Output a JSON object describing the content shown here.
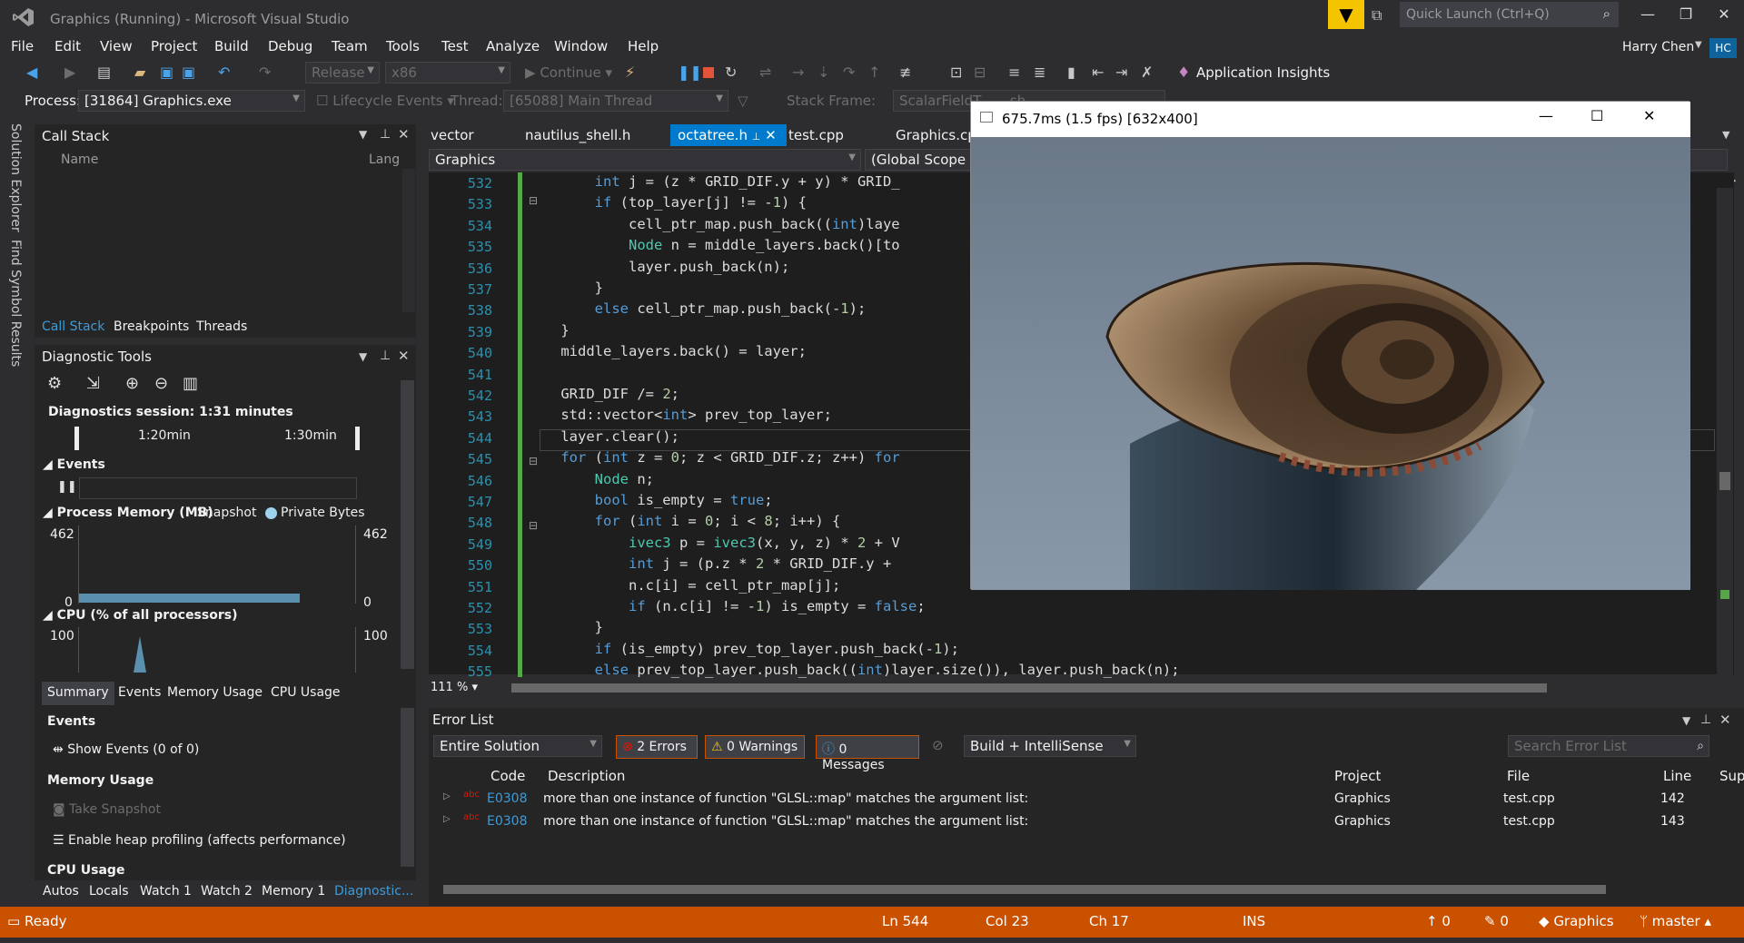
{
  "window": {
    "title": "Graphics (Running) - Microsoft Visual Studio",
    "quick_launch": "Quick Launch (Ctrl+Q)",
    "user": "Harry Chen",
    "avatar": "HC"
  },
  "menu": [
    "File",
    "Edit",
    "View",
    "Project",
    "Build",
    "Debug",
    "Team",
    "Tools",
    "Test",
    "Analyze",
    "Window",
    "Help"
  ],
  "toolbar": {
    "config": "Release",
    "platform": "x86",
    "continue": "Continue",
    "app_insights": "Application Insights"
  },
  "debugbar": {
    "process_label": "Process:",
    "process": "[31864] Graphics.exe",
    "lifecycle": "Lifecycle Events",
    "thread_label": "Thread:",
    "thread": "[65088] Main Thread",
    "stackframe_label": "Stack Frame:",
    "stackframe": "ScalarFieldT...                              ...sh..."
  },
  "side_tabs": [
    "Solution Explorer",
    "Find Symbol Results"
  ],
  "callstack": {
    "title": "Call Stack",
    "col_name": "Name",
    "col_lang": "Lang",
    "tabs": [
      "Call Stack",
      "Breakpoints",
      "Threads"
    ]
  },
  "diag": {
    "title": "Diagnostic Tools",
    "session": "Diagnostics session: 1:31 minutes",
    "t1": "1:20min",
    "t2": "1:30min",
    "events": "Events",
    "memory": "Process Memory (MB)",
    "snapshot": "Snapshot",
    "private": "Private Bytes",
    "mem_max": "462",
    "mem_min": "0",
    "cpu": "CPU (% of all processors)",
    "cpu_max": "100",
    "tabs": [
      "Summary",
      "Events",
      "Memory Usage",
      "CPU Usage"
    ],
    "sec_events": "Events",
    "show_events": "Show Events (0 of 0)",
    "sec_memory": "Memory Usage",
    "take_snapshot": "Take Snapshot",
    "heap": "Enable heap profiling (affects performance)",
    "sec_cpu": "CPU Usage"
  },
  "bottom_tabs": [
    "Autos",
    "Locals",
    "Watch 1",
    "Watch 2",
    "Memory 1",
    "Diagnostic..."
  ],
  "doc_tabs": [
    "vector",
    "nautilus_shell.h",
    "octatree.h",
    "test.cpp",
    "Graphics.cpp"
  ],
  "nav": {
    "project": "Graphics",
    "scope": "(Global Scope"
  },
  "zoom": "111 %",
  "code": {
    "start": 532,
    "lines": [
      "        int j = (z * GRID_DIF.y + y) * GRID_",
      "        if (top_layer[j] != -1) {",
      "            cell_ptr_map.push_back((int)laye",
      "            Node n = middle_layers.back()[to",
      "            layer.push_back(n);",
      "        }",
      "        else cell_ptr_map.push_back(-1);",
      "    }",
      "    middle_layers.back() = layer;",
      "",
      "    GRID_DIF /= 2;",
      "    std::vector<int> prev_top_layer;",
      "    layer.clear();",
      "    for (int z = 0; z < GRID_DIF.z; z++) for",
      "        Node n;",
      "        bool is_empty = true;",
      "        for (int i = 0; i < 8; i++) {",
      "            ivec3 p = ivec3(x, y, z) * 2 + V",
      "            int j = (p.z * 2 * GRID_DIF.y + ",
      "            n.c[i] = cell_ptr_map[j];",
      "            if (n.c[i] != -1) is_empty = false;",
      "        }",
      "        if (is_empty) prev_top_layer.push_back(-1);",
      "        else prev_top_layer.push_back((int)layer.size()), layer.push_back(n);"
    ]
  },
  "popup": {
    "title": "675.7ms (1.5 fps) [632x400]"
  },
  "errors": {
    "title": "Error List",
    "scope": "Entire Solution",
    "errors": "2 Errors",
    "warnings": "0 Warnings",
    "messages": "0 Messages",
    "build": "Build + IntelliSense",
    "search": "Search Error List",
    "cols": {
      "code": "Code",
      "desc": "Description",
      "project": "Project",
      "file": "File",
      "line": "Line",
      "sup": "Sup"
    },
    "rows": [
      {
        "code": "E0308",
        "desc": "more than one instance of function \"GLSL::map\" matches the argument list:",
        "project": "Graphics",
        "file": "test.cpp",
        "line": "142"
      },
      {
        "code": "E0308",
        "desc": "more than one instance of function \"GLSL::map\" matches the argument list:",
        "project": "Graphics",
        "file": "test.cpp",
        "line": "143"
      }
    ]
  },
  "status": {
    "ready": "Ready",
    "ln": "Ln 544",
    "col": "Col 23",
    "ch": "Ch 17",
    "ins": "INS",
    "up": "0",
    "pen": "0",
    "repo": "Graphics",
    "branch": "master"
  },
  "colors": {
    "accent": "#007acc",
    "status": "#ca5100",
    "feedback": "#f5c400"
  }
}
